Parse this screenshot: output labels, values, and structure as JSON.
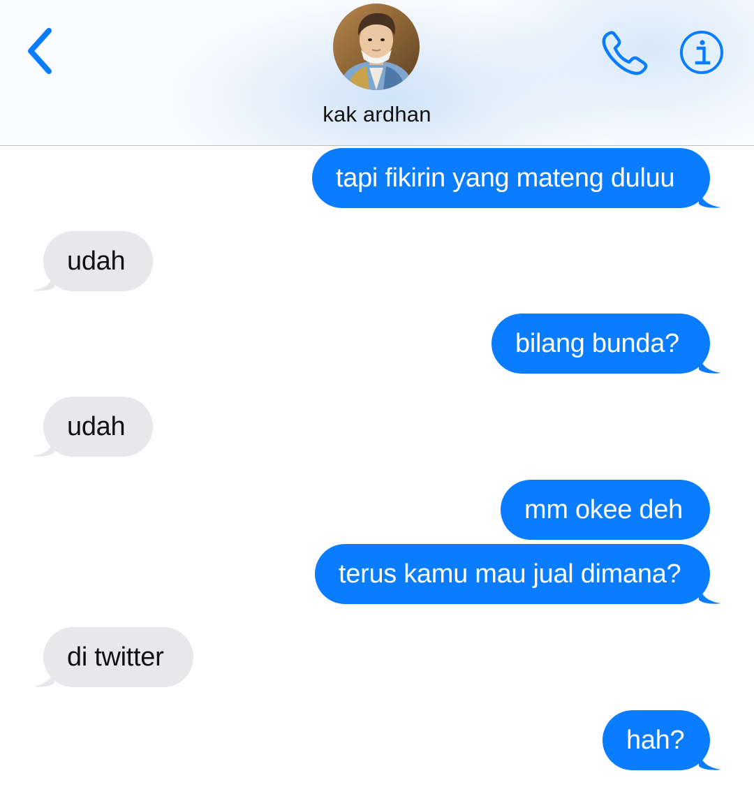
{
  "header": {
    "contact_name": "kak ardhan",
    "avatar_icon": "contact-photo",
    "back_icon": "chevron-left-icon",
    "call_icon": "phone-icon",
    "info_icon": "info-icon",
    "accent_color": "#0a7cff"
  },
  "messages": [
    {
      "direction": "outgoing",
      "text": "tapi fikirin yang mateng duluu",
      "tail": true
    },
    {
      "direction": "incoming",
      "text": "udah",
      "tail": true
    },
    {
      "direction": "outgoing",
      "text": "bilang bunda?",
      "tail": true
    },
    {
      "direction": "incoming",
      "text": "udah",
      "tail": true
    },
    {
      "direction": "outgoing",
      "text": "mm okee deh",
      "tail": false
    },
    {
      "direction": "outgoing",
      "text": "terus kamu mau jual dimana?",
      "tail": true
    },
    {
      "direction": "incoming",
      "text": "di twitter",
      "tail": true
    },
    {
      "direction": "outgoing",
      "text": "hah?",
      "tail": true
    }
  ],
  "colors": {
    "outgoing_bubble": "#0a7cff",
    "incoming_bubble": "#e8e8ec"
  }
}
